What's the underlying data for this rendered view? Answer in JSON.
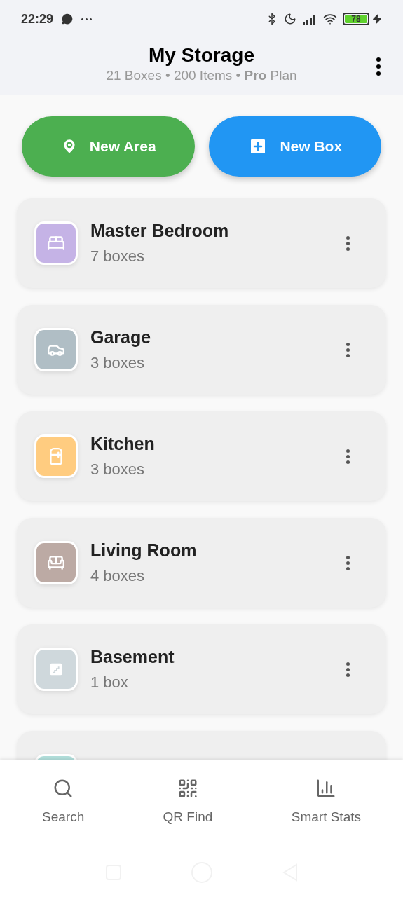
{
  "status_bar": {
    "time": "22:29",
    "battery": "78"
  },
  "header": {
    "title": "My Storage",
    "subtitle": "21 Boxes • 200 Items • **Pro** Plan"
  },
  "actions": [
    {
      "kind": "area",
      "label": "New Area",
      "color": "#4caf50"
    },
    {
      "kind": "box",
      "label": "New Box",
      "color": "#2196f3"
    }
  ],
  "areas": [
    {
      "kind": "bed",
      "name": "Master Bedroom",
      "count": "7 boxes",
      "color": "#c5b3e6"
    },
    {
      "kind": "car",
      "name": "Garage",
      "count": "3 boxes",
      "color": "#b0bec5"
    },
    {
      "kind": "fridge",
      "name": "Kitchen",
      "count": "3 boxes",
      "color": "#ffcc80"
    },
    {
      "kind": "sofa",
      "name": "Living Room",
      "count": "4 boxes",
      "color": "#bcaaa4"
    },
    {
      "kind": "stairs",
      "name": "Basement",
      "count": "1 box",
      "color": "#cfd8dc"
    },
    {
      "kind": "partial",
      "color": "#b2dfdb"
    }
  ],
  "bottom_nav": [
    {
      "kind": "search",
      "label": "Search"
    },
    {
      "kind": "qr",
      "label": "QR Find"
    },
    {
      "kind": "stats",
      "label": "Smart Stats"
    }
  ]
}
